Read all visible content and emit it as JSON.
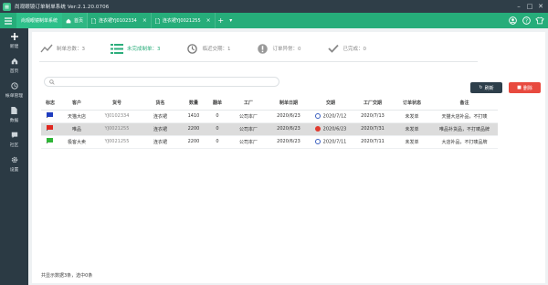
{
  "app": {
    "title": "尚观眼镜订单制单系统 Ver:2.1.20.0706"
  },
  "tabs": {
    "system": "尚观眼镜制单系统",
    "items": [
      {
        "label": "首页"
      },
      {
        "label": "连衣裙YJ0102334"
      },
      {
        "label": "连衣裙YJ0021255"
      }
    ],
    "add": "+",
    "dropdown": "▾"
  },
  "sidebar": {
    "items": [
      {
        "label": "新建"
      },
      {
        "label": "首页"
      },
      {
        "label": "帐单管理"
      },
      {
        "label": "数据"
      },
      {
        "label": "社区"
      },
      {
        "label": "设置"
      }
    ]
  },
  "stats": [
    {
      "label": "制单总数：3"
    },
    {
      "label": "未完成制单：3"
    },
    {
      "label": "临近交期：1"
    },
    {
      "label": "订单异常：0"
    },
    {
      "label": "已完成：0"
    }
  ],
  "toolbar": {
    "refresh": "刷新",
    "delete": "删除"
  },
  "table": {
    "headers": [
      "标志",
      "客户",
      "货号",
      "货名",
      "数量",
      "翻单",
      "工厂",
      "制单日期",
      "交期",
      "工厂交期",
      "订单状态",
      "备注"
    ],
    "rows": [
      {
        "flag_color": "#1f3dbf",
        "customer": "天猫大店",
        "order_no": "YJ0102334",
        "name": "连衣裙",
        "qty": "1410",
        "repeat": "0",
        "factory": "公司本厂",
        "date": "2020/6/23",
        "due_status": "blue",
        "due": "2020/7/12",
        "factory_due": "2020/7/13",
        "status": "未发单",
        "note": "天猫大店补品，不打唛"
      },
      {
        "flag_color": "#e0271f",
        "customer": "唯品",
        "order_no": "YJ0021255",
        "name": "连衣裙",
        "qty": "2200",
        "repeat": "0",
        "factory": "公司本厂",
        "date": "2020/6/23",
        "due_status": "red",
        "due": "2020/6/23",
        "factory_due": "2020/7/31",
        "status": "未发单",
        "note": "唯品补货品，不打唛品牌"
      },
      {
        "flag_color": "#2fb537",
        "customer": "极客大卖",
        "order_no": "YJ0021255",
        "name": "连衣裙",
        "qty": "2200",
        "repeat": "0",
        "factory": "公司本厂",
        "date": "2020/6/23",
        "due_status": "blue",
        "due": "2020/7/11",
        "factory_due": "2020/7/11",
        "status": "未发单",
        "note": "大店补品，不打唛品牌"
      }
    ]
  },
  "footer": {
    "text": "共显示数据3条，选中0条"
  },
  "colors": {
    "titlebar": "#2f3e48",
    "tabbar": "#26ad7a",
    "sidebar": "#2b3a44",
    "accent": "#2cae7c",
    "refresh": "#2e3f4b",
    "delete": "#e84a3f"
  }
}
